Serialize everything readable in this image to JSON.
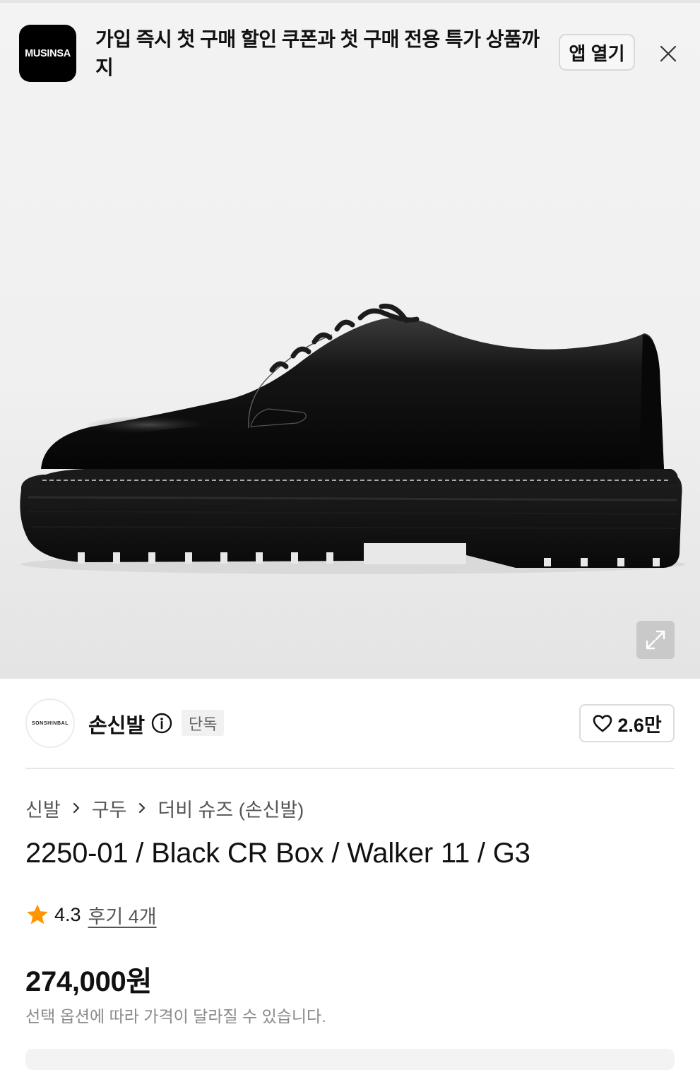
{
  "app_banner": {
    "logo_text": "MUSINSA",
    "message": "가입 즉시 첫 구매 할인 쿠폰과 첫 구매 전용 특가 상품까지",
    "open_button": "앱 열기",
    "close_icon": "close-icon"
  },
  "product_image": {
    "subject": "black leather derby shoe with lug sole",
    "expand_icon": "expand-icon"
  },
  "brand": {
    "logo_text": "SONSHINBAL",
    "name": "손신발",
    "info_icon": "info-icon",
    "badge": "단독",
    "likes": "2.6만",
    "heart_icon": "heart-icon"
  },
  "breadcrumb": [
    "신발",
    "구두",
    "더비 슈즈 (손신발)"
  ],
  "product": {
    "title": "2250-01 / Black CR Box / Walker 11 / G3",
    "rating": "4.3",
    "reviews": "후기 4개",
    "price": "274,000원",
    "price_note": "선택 옵션에 따라 가격이 달라질 수 있습니다."
  },
  "colors": {
    "star": "#ff9500",
    "text": "#111111",
    "muted": "#8a8a8a"
  }
}
